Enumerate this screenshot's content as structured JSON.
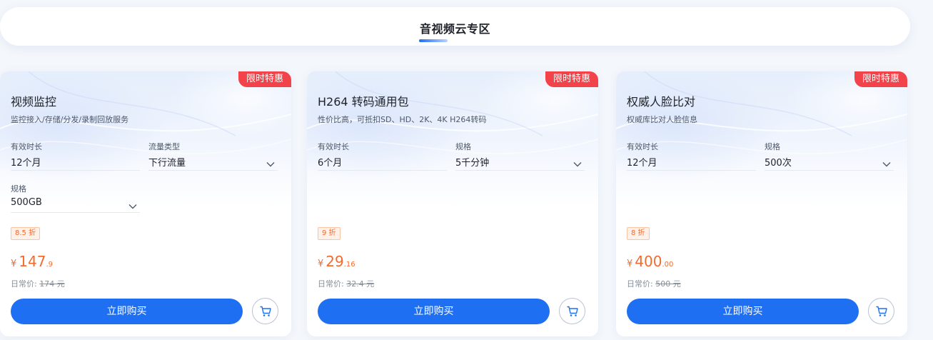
{
  "header": {
    "title": "音视频云专区"
  },
  "colors": {
    "accent": "#1e6ff2",
    "badge": "#f2424a",
    "price": "#f26b2e"
  },
  "cards": [
    {
      "badge": "限时特惠",
      "title": "视频监控",
      "desc": "监控接入/存储/分发/录制回放服务",
      "fields": [
        {
          "label": "有效时长",
          "value": "12个月",
          "dropdown": false
        },
        {
          "label": "流量类型",
          "value": "下行流量",
          "dropdown": true
        },
        {
          "label": "规格",
          "value": "500GB",
          "dropdown": true
        }
      ],
      "discount": "8.5 折",
      "currency": "¥",
      "price_int": "147",
      "price_dec": ".9",
      "orig_label": "日常价:",
      "orig_price": "174 元",
      "buy_label": "立即购买",
      "cart_icon": "cart-icon"
    },
    {
      "badge": "限时特惠",
      "title": "H264 转码通用包",
      "desc": "性价比高，可抵扣SD、HD、2K、4K H264转码",
      "fields": [
        {
          "label": "有效时长",
          "value": "6个月",
          "dropdown": false
        },
        {
          "label": "规格",
          "value": "5千分钟",
          "dropdown": true
        }
      ],
      "discount": "9 折",
      "currency": "¥",
      "price_int": "29",
      "price_dec": ".16",
      "orig_label": "日常价:",
      "orig_price": "32.4 元",
      "buy_label": "立即购买",
      "cart_icon": "cart-icon"
    },
    {
      "badge": "限时特惠",
      "title": "权威人脸比对",
      "desc": "权威库比对人脸信息",
      "fields": [
        {
          "label": "有效时长",
          "value": "12个月",
          "dropdown": false
        },
        {
          "label": "规格",
          "value": "500次",
          "dropdown": true
        }
      ],
      "discount": "8 折",
      "currency": "¥",
      "price_int": "400",
      "price_dec": ".00",
      "orig_label": "日常价:",
      "orig_price": "500 元",
      "buy_label": "立即购买",
      "cart_icon": "cart-icon"
    }
  ]
}
